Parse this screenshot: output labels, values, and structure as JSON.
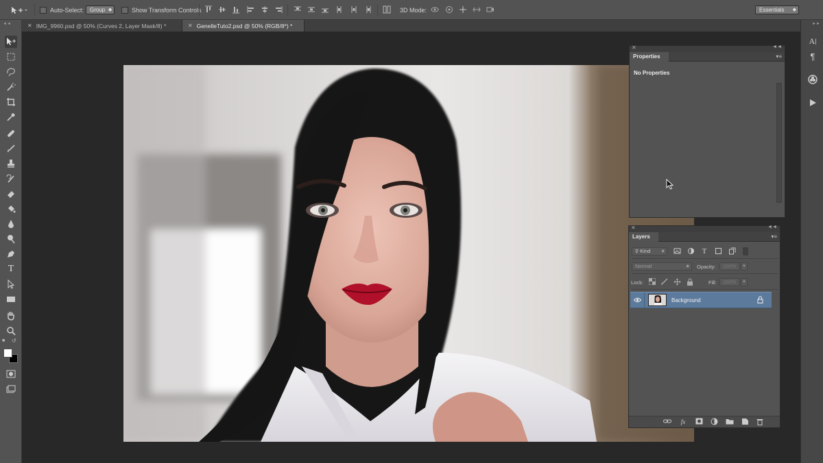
{
  "options_bar": {
    "auto_select_label": "Auto-Select:",
    "auto_select_value": "Group",
    "transform_label": "Show Transform Controls",
    "three_d_label": "3D Mode:",
    "workspace": "Essentials"
  },
  "tabs": [
    {
      "title": "IMG_9960.psd @ 50% (Curves 2, Layer Mask/8) *",
      "active": false
    },
    {
      "title": "GenelleTuto2.psd @ 50% (RGB/8*) *",
      "active": true
    }
  ],
  "properties_panel": {
    "tab_label": "Properties",
    "message": "No Properties"
  },
  "layers_panel": {
    "tab_label": "Layers",
    "filter_kind": "Kind",
    "blend_mode": "Normal",
    "opacity_label": "Opacity:",
    "opacity_value": "100%",
    "lock_label": "Lock:",
    "fill_label": "Fill:",
    "fill_value": "100%",
    "layers": [
      {
        "name": "Background",
        "visible": true,
        "locked": true,
        "selected": true
      }
    ],
    "footer_icons": [
      "link-layers-icon",
      "fx-icon",
      "add-mask-icon",
      "adjustment-layer-icon",
      "new-group-icon",
      "new-layer-icon",
      "trash-icon"
    ]
  },
  "colors": {
    "ui_panel": "#535353",
    "ui_dark": "#282828",
    "selection_blue": "#5c7a9c",
    "lip_red": "#b0102a"
  }
}
